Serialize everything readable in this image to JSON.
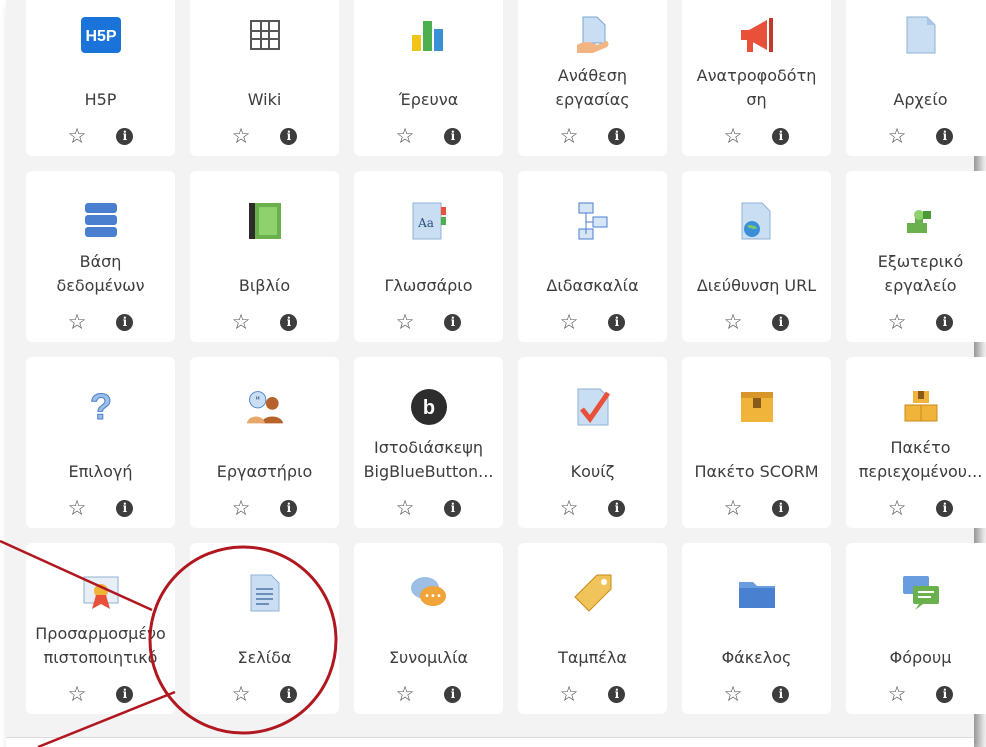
{
  "tiles": [
    {
      "label": "H5P",
      "icon": "h5p-icon"
    },
    {
      "label": "Wiki",
      "icon": "wiki-icon"
    },
    {
      "label": "Έρευνα",
      "icon": "survey-icon"
    },
    {
      "label": "Ανάθεση\nεργασίας",
      "icon": "assignment-icon"
    },
    {
      "label": "Ανατροφοδότη\nση",
      "icon": "feedback-icon"
    },
    {
      "label": "Αρχείο",
      "icon": "file-icon"
    },
    {
      "label": "Βάση\nδεδομένων",
      "icon": "database-icon"
    },
    {
      "label": "Βιβλίο",
      "icon": "book-icon"
    },
    {
      "label": "Γλωσσάριο",
      "icon": "glossary-icon"
    },
    {
      "label": "Διδασκαλία",
      "icon": "lesson-icon"
    },
    {
      "label": "Διεύθυνση URL",
      "icon": "url-icon"
    },
    {
      "label": "Εξωτερικό\nεργαλείο",
      "icon": "external-tool-icon"
    },
    {
      "label": "Επιλογή",
      "icon": "choice-icon"
    },
    {
      "label": "Εργαστήριο",
      "icon": "workshop-icon"
    },
    {
      "label": "Ιστοδιάσκεψη\nBigBlueButton...",
      "icon": "bigbluebutton-icon"
    },
    {
      "label": "Κουίζ",
      "icon": "quiz-icon"
    },
    {
      "label": "Πακέτο SCORM",
      "icon": "scorm-icon"
    },
    {
      "label": "Πακέτο\nπεριεχομένου...",
      "icon": "imscp-icon"
    },
    {
      "label": "Προσαρμοσμένο\nπιστοποιητικό",
      "icon": "certificate-icon"
    },
    {
      "label": "Σελίδα",
      "icon": "page-icon"
    },
    {
      "label": "Συνομιλία",
      "icon": "chat-icon"
    },
    {
      "label": "Ταμπέλα",
      "icon": "label-icon"
    },
    {
      "label": "Φάκελος",
      "icon": "folder-icon"
    },
    {
      "label": "Φόρουμ",
      "icon": "forum-icon"
    }
  ],
  "actions": {
    "star": "☆",
    "info": "i"
  },
  "annotation_color": "#b0171f"
}
